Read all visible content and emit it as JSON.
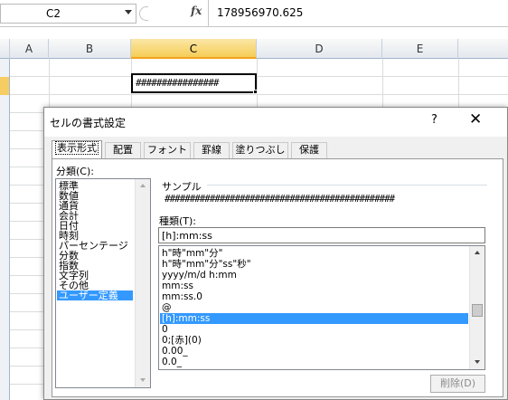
{
  "formula_bar": {
    "name_box": "C2",
    "fx_label": "fx",
    "value": "178956970.625"
  },
  "sheet": {
    "columns": [
      "A",
      "B",
      "C",
      "D",
      "E"
    ],
    "selected_column": "C",
    "active_cell_display": "################"
  },
  "dialog": {
    "title": "セルの書式設定",
    "help": "?",
    "close": "✕",
    "tabs": [
      "表示形式",
      "配置",
      "フォント",
      "罫線",
      "塗りつぶし",
      "保護"
    ],
    "active_tab": "表示形式",
    "category_label": "分類(C):",
    "categories": [
      "標準",
      "数値",
      "通貨",
      "会計",
      "日付",
      "時刻",
      "パーセンテージ",
      "分数",
      "指数",
      "文字列",
      "その他",
      "ユーザー定義"
    ],
    "selected_category": "ユーザー定義",
    "sample_label": "サンプル",
    "sample_value": "##############################################",
    "type_label": "種類(T):",
    "type_value": "[h]:mm:ss",
    "type_items": [
      "h\"時\"mm\"分\"",
      "h\"時\"mm\"分\"ss\"秒\"",
      "yyyy/m/d h:mm",
      "mm:ss",
      "mm:ss.0",
      "@",
      "[h]:mm:ss",
      "0",
      "0;[赤](0)",
      "0.00_",
      "0.0_"
    ],
    "selected_type": "[h]:mm:ss",
    "delete_button": "削除(D)"
  }
}
